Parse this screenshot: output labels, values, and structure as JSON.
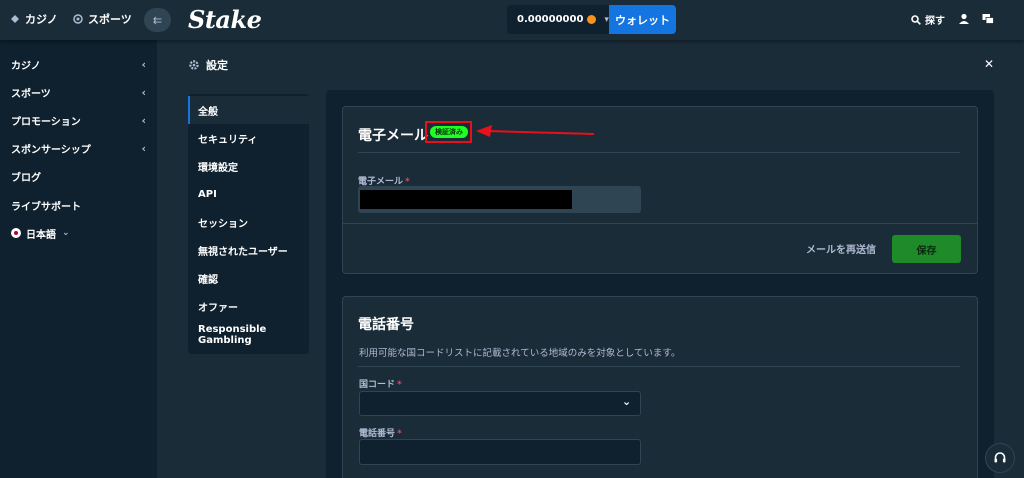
{
  "header": {
    "tabs": [
      {
        "label": "カジノ",
        "icon": "casino-chip-icon"
      },
      {
        "label": "スポーツ",
        "icon": "sports-ball-icon"
      }
    ],
    "logo": "Stake",
    "balance": "0.00000000",
    "wallet_label": "ウォレット",
    "search_label": "探す"
  },
  "sidebar": {
    "items": [
      {
        "label": "カジノ"
      },
      {
        "label": "スポーツ"
      },
      {
        "label": "プロモーション"
      },
      {
        "label": "スポンサーシップ"
      },
      {
        "label": "ブログ"
      },
      {
        "label": "ライブサポート"
      },
      {
        "label": "日本語"
      }
    ]
  },
  "settings": {
    "title": "設定",
    "nav": [
      {
        "label": "全般",
        "active": true
      },
      {
        "label": "セキュリティ"
      },
      {
        "label": "環境設定"
      },
      {
        "label": "API"
      },
      {
        "label": "セッション"
      },
      {
        "label": "無視されたユーザー"
      },
      {
        "label": "確認"
      },
      {
        "label": "オファー"
      },
      {
        "label": "Responsible Gambling"
      }
    ]
  },
  "email_card": {
    "title": "電子メール",
    "badge": "検証済み",
    "field_label": "電子メール",
    "resend_label": "メールを再送信",
    "save_label": "保存"
  },
  "phone_card": {
    "title": "電話番号",
    "helper": "利用可能な国コードリストに記載されている地域のみを対象としています。",
    "country_label": "国コード",
    "phone_label": "電話番号"
  },
  "colors": {
    "accent": "#1475e1",
    "verified": "#1fff20",
    "save": "#1f8a2a",
    "annotation": "#e8101a"
  }
}
